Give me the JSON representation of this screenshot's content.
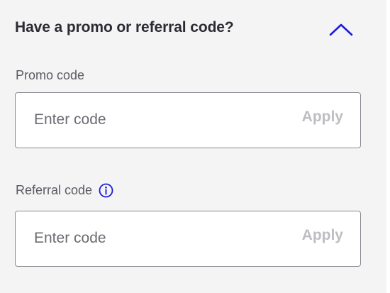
{
  "promo_section": {
    "title": "Have a promo or referral code?",
    "collapse_icon": "chevron-up-icon",
    "accent_color": "#1a1adb",
    "promo": {
      "label": "Promo code",
      "placeholder": "Enter code",
      "value": "",
      "apply_label": "Apply"
    },
    "referral": {
      "label": "Referral code",
      "info_icon": "info-icon",
      "placeholder": "Enter code",
      "value": "",
      "apply_label": "Apply"
    }
  }
}
